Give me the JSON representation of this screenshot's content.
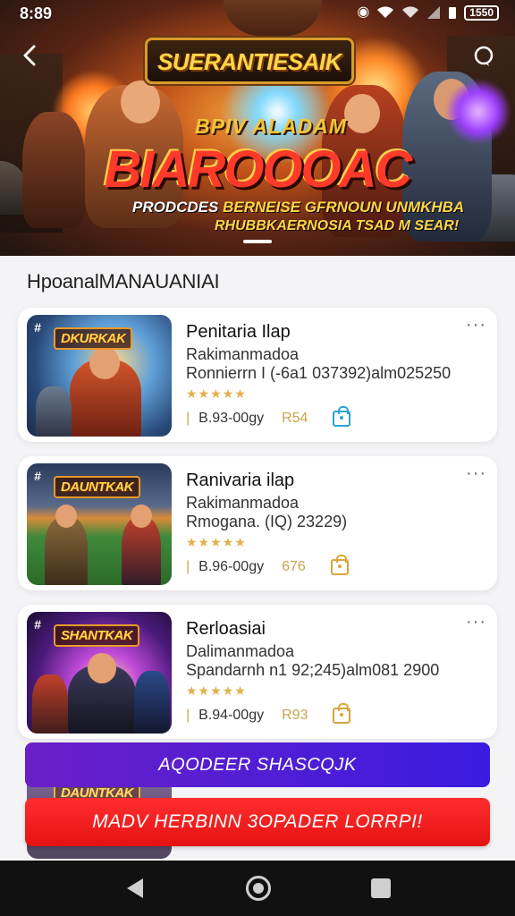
{
  "status_bar": {
    "time": "8:89",
    "battery": "1550"
  },
  "hero": {
    "logo_small": "",
    "logo_text": "SUERANTIESAIK",
    "tagline": "BPIV  ALADAM",
    "big_title": "BIAROOOAC",
    "subtitle_left": "PRODCDES",
    "subtitle_right": "BERNEISE GFRNOUN UNMKHBA",
    "subtitle_line2": "RHUBBKAERNOSIA TSAD M SEAR!"
  },
  "section_title": "HpoanalMANAUANIAI",
  "cards": [
    {
      "thumb_label": "DKURKAK",
      "title": "Penitaria Ilap",
      "subtitle": "Rakimanmadoa",
      "meta": "Ronnierrn I (-6a1 037392)alm025250",
      "stars": "★★★★★",
      "size": "B.93-00gy",
      "price": "R54",
      "shop_color": "#2aa3d4"
    },
    {
      "thumb_label": "DAUNTKAK",
      "title": "Ranivaria ilap",
      "subtitle": "Rakimanmadoa",
      "meta": "Rmogana.  (IQ) 23229)",
      "stars": "★★★★★",
      "size": "B.96-00gy",
      "price": "676",
      "shop_color": "#d9a63a"
    },
    {
      "thumb_label": "SHANTKAK",
      "title": "Rerloasiai",
      "subtitle": "Dalimanmadoa",
      "meta": "Spandarnh      n1 92;245)alm081 2900",
      "stars": "★★★★★",
      "size": "B.94-00gy",
      "price": "R93",
      "shop_color": "#d9a63a"
    }
  ],
  "peek_label": "DAUNTKAK",
  "buttons": {
    "primary_purple": "AQODEER SHASCQJK",
    "primary_red": "MADV HERBINN 3OPADER LORRPI!"
  },
  "icons": {
    "back": "chevron-left-icon",
    "search": "search-icon",
    "more": "more-dots-icon",
    "shop": "shopping-bag-icon"
  }
}
